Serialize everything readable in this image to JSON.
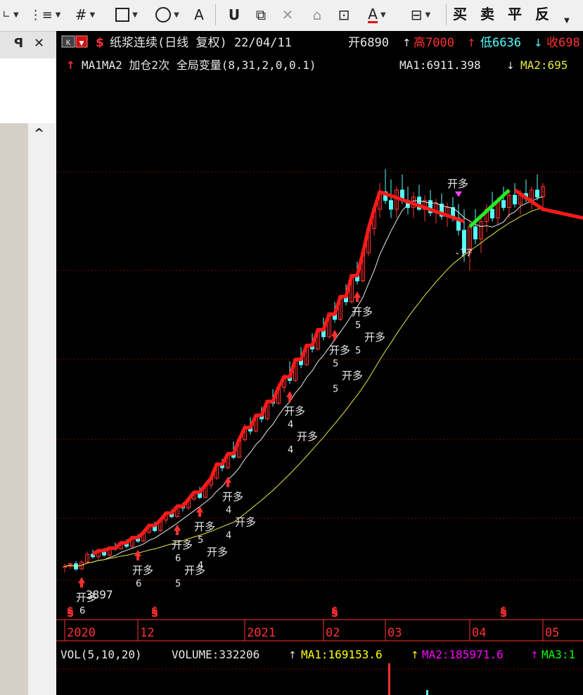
{
  "toolbar": {
    "draw_text_glyph": "A",
    "buy_label": "买",
    "sell_label": "卖",
    "close_label": "平",
    "reverse_label": "反"
  },
  "left_panel": {
    "pin_glyph": "ꟼ",
    "close_glyph": "✕",
    "scroll_up_glyph": "^"
  },
  "chart_data": {
    "type": "candlestick",
    "header": {
      "k_button": "K",
      "dollar_icon": "$",
      "title": "纸浆连续(日线 复权) 22/04/11",
      "open": "开6890",
      "high": "高7000",
      "low": "低6636",
      "close": "收698",
      "indicator_line": "MA1MA2 加仓2次 全局变量(8,31,2,0,0.1)",
      "ma1_text": "MA1:6911.398",
      "ma2_text": "MA2:695"
    },
    "x_axis_labels": [
      "2020",
      "12",
      "2021",
      "02",
      "03",
      "04",
      "05"
    ],
    "signal_marker_label": "S",
    "price_annotation": "3897",
    "top_annotation": "-77",
    "trade_signal_label": "开多",
    "position_counts": [
      "6",
      "5",
      "4",
      "5",
      "4",
      "5",
      "4"
    ],
    "volume_panel": {
      "label": "VOL(5,10,20)",
      "volume": "VOLUME:332206",
      "ma1": "MA1:169153.6",
      "ma2": "MA2:185971.6",
      "ma3": "MA3:1"
    },
    "colors": {
      "background": "#000000",
      "up_candle": "#ff3030",
      "down_candle": "#54ffff",
      "ma_short": "#e8e8e8",
      "ma_long": "#e6e640",
      "position_line_long": "#ff1a1a",
      "position_line_short": "#22ee22",
      "grid": "#7a0000",
      "axis_text": "#ff3030",
      "header_text": "#e8e8e8",
      "vol_ma1": "#ffff00",
      "vol_ma2": "#ff00ff",
      "vol_ma3": "#00ff00"
    },
    "candles": [
      [
        4900,
        4920,
        4870,
        4905
      ],
      [
        4905,
        4930,
        4890,
        4920
      ],
      [
        4920,
        4935,
        4880,
        4890
      ],
      [
        4890,
        4940,
        4885,
        4930
      ],
      [
        4930,
        4990,
        4920,
        4975
      ],
      [
        4975,
        5000,
        4950,
        4960
      ],
      [
        4960,
        5005,
        4945,
        4995
      ],
      [
        4995,
        5010,
        4960,
        4970
      ],
      [
        4970,
        5020,
        4960,
        5010
      ],
      [
        5010,
        5040,
        4995,
        5005
      ],
      [
        5005,
        5050,
        5000,
        5040
      ],
      [
        5040,
        5060,
        5010,
        5020
      ],
      [
        5020,
        5080,
        5010,
        5070
      ],
      [
        5070,
        5090,
        5040,
        5050
      ],
      [
        5050,
        5110,
        5045,
        5100
      ],
      [
        5100,
        5150,
        5090,
        5140
      ],
      [
        5140,
        5160,
        5100,
        5110
      ],
      [
        5110,
        5180,
        5100,
        5170
      ],
      [
        5170,
        5220,
        5150,
        5210
      ],
      [
        5210,
        5230,
        5180,
        5190
      ],
      [
        5190,
        5260,
        5185,
        5250
      ],
      [
        5250,
        5270,
        5220,
        5240
      ],
      [
        5240,
        5300,
        5230,
        5290
      ],
      [
        5290,
        5340,
        5280,
        5330
      ],
      [
        5330,
        5360,
        5290,
        5300
      ],
      [
        5300,
        5380,
        5295,
        5370
      ],
      [
        5370,
        5420,
        5350,
        5410
      ],
      [
        5410,
        5500,
        5400,
        5490
      ],
      [
        5490,
        5520,
        5450,
        5470
      ],
      [
        5470,
        5560,
        5460,
        5550
      ],
      [
        5550,
        5620,
        5520,
        5530
      ],
      [
        5530,
        5640,
        5525,
        5630
      ],
      [
        5630,
        5720,
        5620,
        5700
      ],
      [
        5700,
        5760,
        5660,
        5680
      ],
      [
        5680,
        5780,
        5670,
        5770
      ],
      [
        5770,
        5820,
        5730,
        5750
      ],
      [
        5750,
        5860,
        5740,
        5850
      ],
      [
        5850,
        5920,
        5820,
        5840
      ],
      [
        5840,
        5940,
        5830,
        5930
      ],
      [
        5930,
        6010,
        5900,
        5990
      ],
      [
        5990,
        6080,
        5950,
        5970
      ],
      [
        5970,
        6100,
        5960,
        6090
      ],
      [
        6090,
        6160,
        6040,
        6060
      ],
      [
        6060,
        6180,
        6050,
        6170
      ],
      [
        6170,
        6240,
        6130,
        6150
      ],
      [
        6150,
        6270,
        6140,
        6260
      ],
      [
        6260,
        6330,
        6200,
        6220
      ],
      [
        6220,
        6360,
        6210,
        6350
      ],
      [
        6350,
        6420,
        6300,
        6320
      ],
      [
        6320,
        6460,
        6310,
        6450
      ],
      [
        6450,
        6520,
        6400,
        6420
      ],
      [
        6420,
        6580,
        6410,
        6570
      ],
      [
        6570,
        6650,
        6520,
        6540
      ],
      [
        6540,
        6720,
        6530,
        6700
      ],
      [
        6700,
        6860,
        6680,
        6840
      ],
      [
        6840,
        6980,
        6800,
        6950
      ],
      [
        6950,
        7100,
        6900,
        7050
      ],
      [
        7050,
        7180,
        6980,
        7000
      ],
      [
        7000,
        7120,
        6900,
        6950
      ],
      [
        6950,
        7080,
        6900,
        7060
      ],
      [
        7060,
        7150,
        6980,
        7000
      ],
      [
        7000,
        7080,
        6920,
        6960
      ],
      [
        6960,
        7050,
        6900,
        7020
      ],
      [
        7020,
        7090,
        6940,
        6950
      ],
      [
        6950,
        7030,
        6880,
        7000
      ],
      [
        7000,
        7060,
        6910,
        6930
      ],
      [
        6930,
        7010,
        6870,
        6980
      ],
      [
        6980,
        7040,
        6890,
        6910
      ],
      [
        6910,
        6990,
        6850,
        6960
      ],
      [
        6960,
        7020,
        6880,
        6900
      ],
      [
        6900,
        6980,
        6800,
        6830
      ],
      [
        6830,
        6950,
        6650,
        6700
      ],
      [
        6700,
        6880,
        6600,
        6850
      ],
      [
        6850,
        6950,
        6750,
        6780
      ],
      [
        6780,
        6900,
        6700,
        6880
      ],
      [
        6880,
        6980,
        6820,
        6950
      ],
      [
        6950,
        7050,
        6880,
        6900
      ],
      [
        6900,
        7020,
        6860,
        7000
      ],
      [
        7000,
        7080,
        6940,
        6960
      ],
      [
        6960,
        7060,
        6900,
        7030
      ],
      [
        7030,
        7100,
        6960,
        6980
      ],
      [
        6980,
        7060,
        6920,
        7040
      ],
      [
        7040,
        7120,
        6990,
        7010
      ],
      [
        7010,
        7080,
        6950,
        7060
      ],
      [
        7060,
        7150,
        7000,
        7020
      ],
      [
        7020,
        7100,
        6960,
        7080
      ]
    ],
    "signals": [
      {
        "i": 3,
        "counts": [
          "6"
        ]
      },
      {
        "i": 13,
        "counts": [
          "6"
        ]
      },
      {
        "i": 20,
        "counts": [
          "6",
          "5"
        ]
      },
      {
        "i": 24,
        "counts": [
          "5",
          "4"
        ]
      },
      {
        "i": 29,
        "counts": [
          "4",
          "4"
        ]
      },
      {
        "i": 40,
        "counts": [
          "4",
          "4"
        ]
      },
      {
        "i": 48,
        "counts": [
          "5",
          "5"
        ]
      },
      {
        "i": 52,
        "counts": [
          "5",
          "5"
        ]
      }
    ],
    "dollar_markers": [
      1,
      16,
      48,
      78
    ],
    "x_label_index": [
      0,
      13,
      32,
      46,
      57,
      72,
      85
    ]
  }
}
